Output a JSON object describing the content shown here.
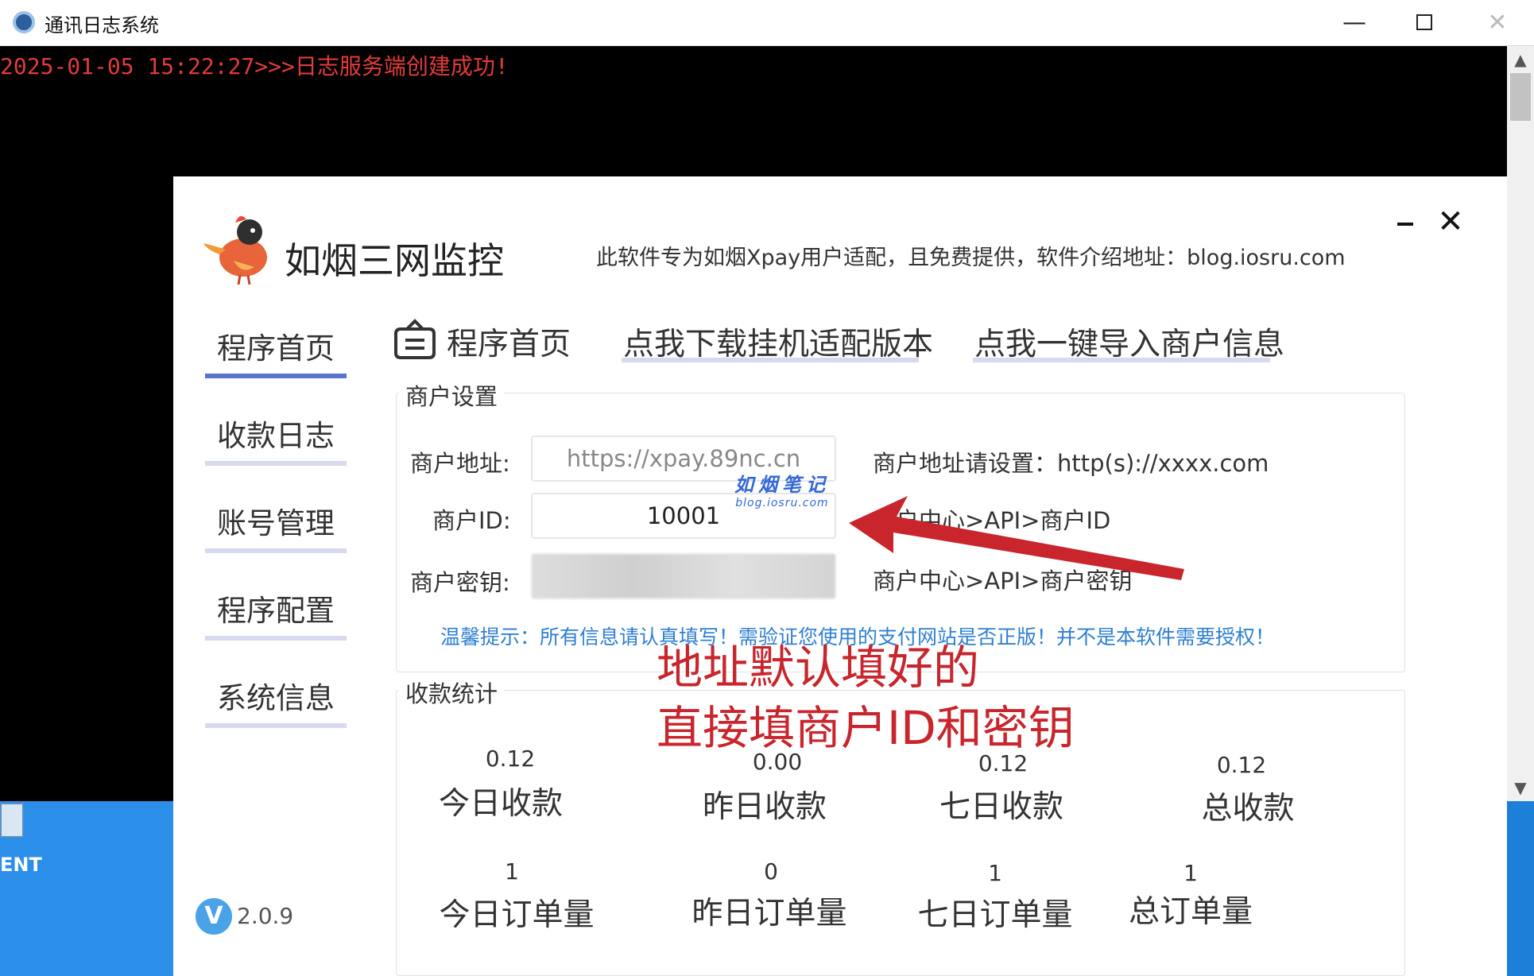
{
  "console": {
    "title": "通讯日志系统",
    "log_line": "2025-01-05 15:22:27>>>日志服务端创建成功!",
    "minimize_glyph": "—",
    "close_glyph": "✕",
    "scroll_up_glyph": "▲",
    "scroll_down_glyph": "▼"
  },
  "desktop": {
    "icon_label": "ENT"
  },
  "app": {
    "title": "如烟三网监控",
    "subtitle": "此软件专为如烟Xpay用户适配，且免费提供，软件介绍地址：blog.iosru.com",
    "close_glyph": "✕",
    "version_badge": "V",
    "version": "2.0.9"
  },
  "sidebar": {
    "items": [
      {
        "label": "程序首页",
        "active": true
      },
      {
        "label": "收款日志"
      },
      {
        "label": "账号管理"
      },
      {
        "label": "程序配置"
      },
      {
        "label": "系统信息"
      }
    ]
  },
  "tabs": {
    "home": "程序首页",
    "download": "点我下载挂机适配版本",
    "import": "点我一键导入商户信息"
  },
  "merchant": {
    "legend": "商户设置",
    "address_label": "商户地址:",
    "address_value": "https://xpay.89nc.cn",
    "address_hint": "商户地址请设置：http(s)://xxxx.com",
    "id_label": "商户ID:",
    "id_value": "10001",
    "id_hint": "商户中心>API>商户ID",
    "key_label": "商户密钥:",
    "key_hint": "商户中心>API>商户密钥",
    "tip": "温馨提示：所有信息请认真填写！需验证您使用的支付网站是否正版！并不是本软件需要授权！"
  },
  "watermark": {
    "main": "如烟笔记",
    "sub": "blog.iosru.com"
  },
  "stats": {
    "legend": "收款统计",
    "row1": [
      {
        "value": "0.12",
        "label": "今日收款"
      },
      {
        "value": "0.00",
        "label": "昨日收款"
      },
      {
        "value": "0.12",
        "label": "七日收款"
      },
      {
        "value": "0.12",
        "label": "总收款"
      }
    ],
    "row2": [
      {
        "value": "1",
        "label": "今日订单量"
      },
      {
        "value": "0",
        "label": "昨日订单量"
      },
      {
        "value": "1",
        "label": "七日订单量"
      },
      {
        "value": "1",
        "label": "总订单量"
      }
    ]
  },
  "annotation": {
    "line1": "地址默认填好的",
    "line2": "直接填商户ID和密钥",
    "color": "#c8252c"
  }
}
